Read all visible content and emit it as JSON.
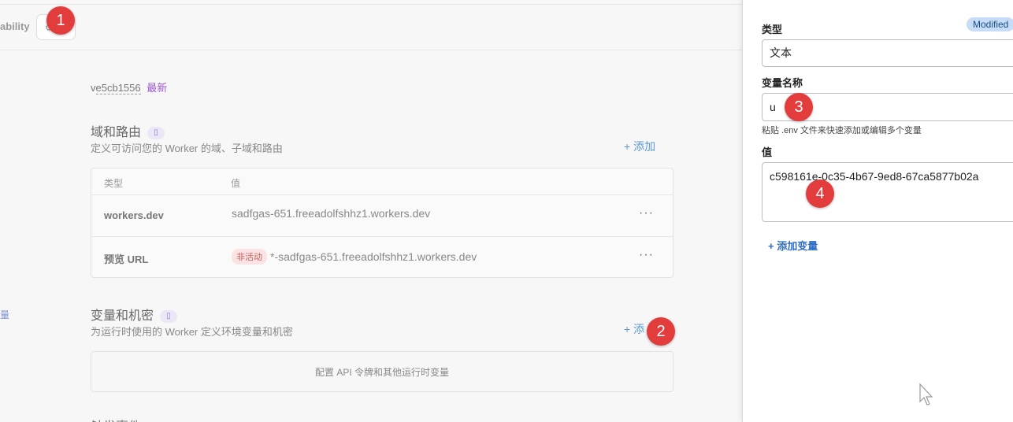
{
  "tabs": {
    "observability_partial": "ability",
    "active_tab_icon": "settings-icon"
  },
  "version": {
    "prefix": "v",
    "hash": "e5cb1556",
    "badge": "最新"
  },
  "domains_section": {
    "title": "域和路由",
    "description": "定义可访问您的 Worker 的域、子域和路由",
    "add_label": "+ 添加",
    "table": {
      "headers": [
        "类型",
        "值"
      ],
      "rows": [
        {
          "type": "workers.dev",
          "value": "sadfgas-651.freeadolfshhz1.workers.dev",
          "badge": "",
          "menu": "···"
        },
        {
          "type": "预览 URL",
          "value": "*-sadfgas-651.freeadolfshhz1.workers.dev",
          "badge": "非活动",
          "menu": "···"
        }
      ]
    }
  },
  "variables_section": {
    "title": "变量和机密",
    "description": "为运行时使用的 Worker 定义环境变量和机密",
    "add_label": "+ 添",
    "empty_text": "配置 API 令牌和其他运行时变量"
  },
  "left_edge_text": "量",
  "next_section_partial": "触发事件",
  "panel": {
    "type_label": "类型",
    "modified_badge": "Modified",
    "type_value": "文本",
    "name_label": "变量名称",
    "name_value": "u",
    "hint": "粘贴 .env 文件来快速添加或编辑多个变量",
    "value_label": "值",
    "value_value": "c598161e-0c35-4b67-9ed8-67ca5877b02a",
    "add_variable": "+ 添加变量"
  },
  "markers": [
    "1",
    "2",
    "3",
    "4"
  ],
  "colors": {
    "marker": "#e23c3c",
    "accent_link": "#2f6dc7",
    "modified_badge_bg": "#c7ddf7",
    "inactive_badge_bg": "#fbe3e3"
  }
}
